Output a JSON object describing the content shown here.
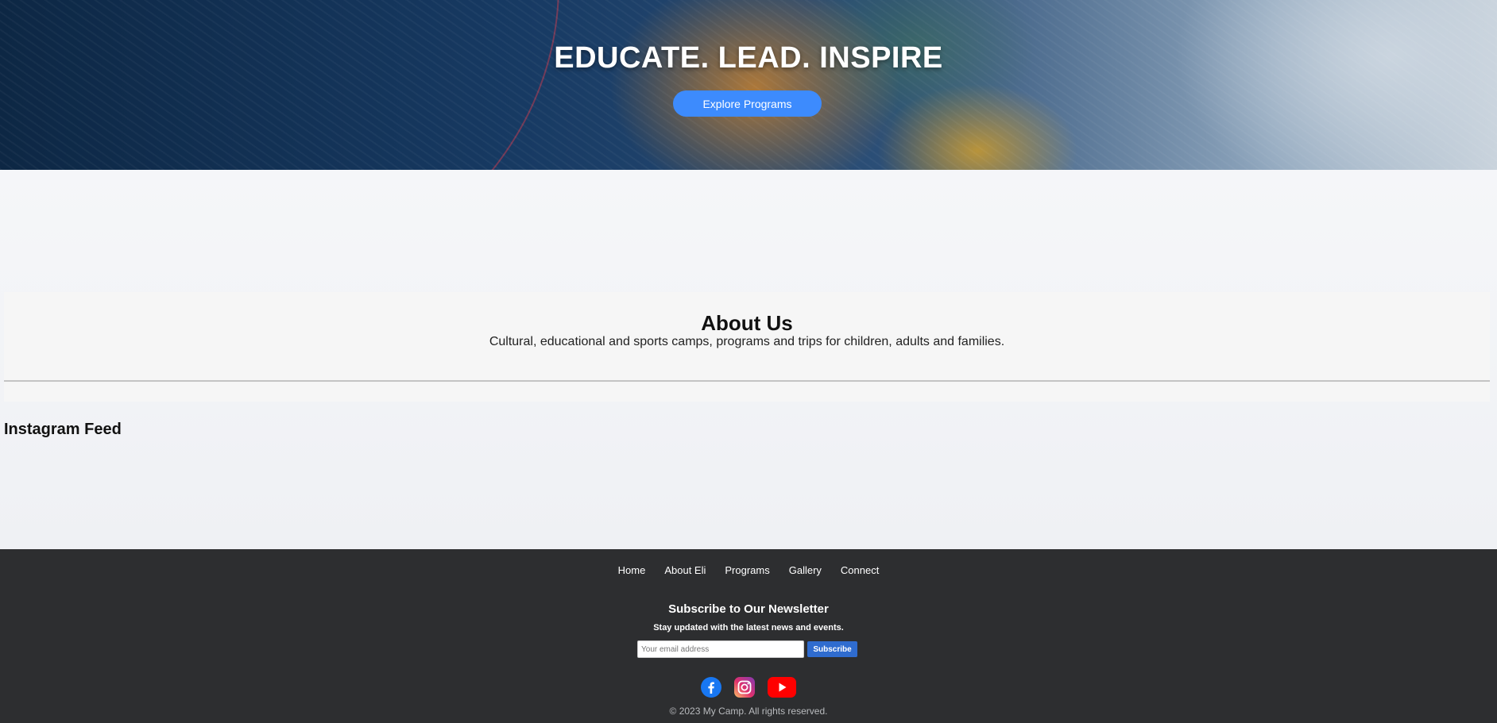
{
  "hero": {
    "title": "EDUCATE. LEAD. INSPIRE",
    "cta_label": "Explore Programs"
  },
  "about": {
    "title": "About Us",
    "text": "Cultural, educational and sports camps, programs and trips for children, adults and families."
  },
  "instagram": {
    "title": "Instagram Feed"
  },
  "footer": {
    "nav": [
      "Home",
      "About Eli",
      "Programs",
      "Gallery",
      "Connect"
    ],
    "newsletter": {
      "title": "Subscribe to Our Newsletter",
      "subtitle": "Stay updated with the latest news and events.",
      "placeholder": "Your email address",
      "button_label": "Subscribe"
    },
    "social": [
      {
        "icon": "facebook-icon",
        "color": "#1877f2"
      },
      {
        "icon": "instagram-icon",
        "color": "#c13584"
      },
      {
        "icon": "youtube-icon",
        "color": "#ff0000"
      }
    ],
    "copyright": "© 2023 My Camp. All rights reserved."
  },
  "colors": {
    "accent": "#3d8bfd",
    "footer_bg": "#2d2e30",
    "subscribe_button": "#2f6ccf"
  }
}
